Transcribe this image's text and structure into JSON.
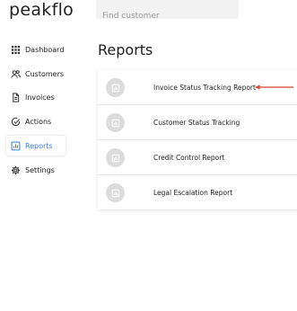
{
  "app": {
    "logo": "peakflo"
  },
  "search": {
    "placeholder": "Find customer",
    "value": ""
  },
  "sidebar": {
    "items": [
      {
        "label": "Dashboard",
        "icon": "grid-icon"
      },
      {
        "label": "Customers",
        "icon": "users-icon"
      },
      {
        "label": "Invoices",
        "icon": "document-icon"
      },
      {
        "label": "Actions",
        "icon": "check-circle-icon"
      },
      {
        "label": "Reports",
        "icon": "chart-icon",
        "active": true
      },
      {
        "label": "Settings",
        "icon": "gear-icon"
      }
    ]
  },
  "main": {
    "title": "Reports",
    "reports": [
      {
        "label": "Invoice Status Tracking Report",
        "icon": "report-chart-icon"
      },
      {
        "label": "Customer Status Tracking",
        "icon": "report-chart-icon"
      },
      {
        "label": "Credit Control Report",
        "icon": "report-chart-icon"
      },
      {
        "label": "Legal Escalation Report",
        "icon": "report-chart-icon"
      }
    ]
  },
  "colors": {
    "accent": "#3b7ce6",
    "annotation_arrow": "#d9412b",
    "icon_circle": "#dcdcdc",
    "search_bg": "#f2f2f2"
  }
}
